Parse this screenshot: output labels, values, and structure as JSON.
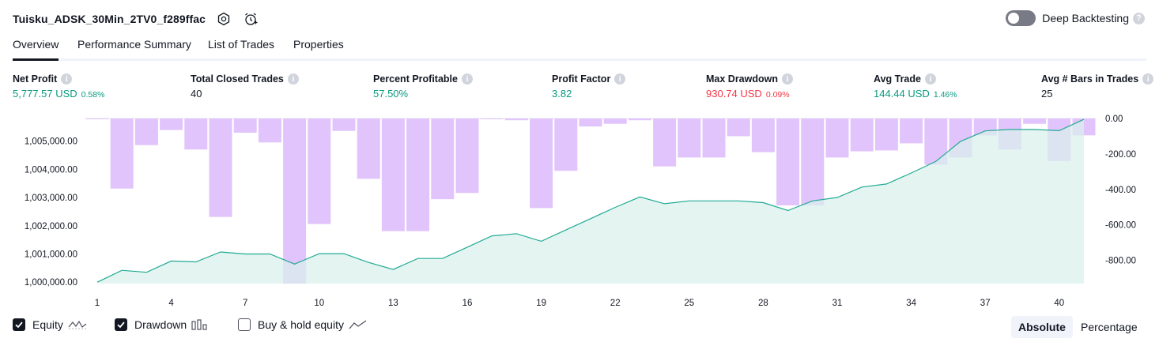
{
  "header": {
    "title": "Tuisku_ADSK_30Min_2TV0_f289ffac"
  },
  "deep_backtesting": {
    "label": "Deep Backtesting",
    "enabled": false
  },
  "tabs": [
    {
      "label": "Overview",
      "active": true
    },
    {
      "label": "Performance Summary",
      "active": false
    },
    {
      "label": "List of Trades",
      "active": false
    },
    {
      "label": "Properties",
      "active": false
    }
  ],
  "stats": {
    "net_profit": {
      "label": "Net Profit",
      "value": "5,777.57 USD",
      "pct": "0.58%"
    },
    "total_closed_trades": {
      "label": "Total Closed Trades",
      "value": "40"
    },
    "percent_profitable": {
      "label": "Percent Profitable",
      "value": "57.50%"
    },
    "profit_factor": {
      "label": "Profit Factor",
      "value": "3.82"
    },
    "max_drawdown": {
      "label": "Max Drawdown",
      "value": "930.74 USD",
      "pct": "0.09%"
    },
    "avg_trade": {
      "label": "Avg Trade",
      "value": "144.44 USD",
      "pct": "1.46%"
    },
    "avg_bars": {
      "label": "Avg # Bars in Trades",
      "value": "25"
    }
  },
  "colors": {
    "equity_line": "#22ab94",
    "equity_fill": "#d8f0eb",
    "drawdown_bar": "#e1c4fb",
    "positive": "#089981",
    "negative": "#f23645"
  },
  "chart_data": {
    "type": "line",
    "x_ticks": [
      "1",
      "4",
      "7",
      "10",
      "13",
      "16",
      "19",
      "22",
      "25",
      "28",
      "31",
      "34",
      "37",
      "40"
    ],
    "left_axis": {
      "ticks": [
        "1,000,000.00",
        "1,001,000.00",
        "1,002,000.00",
        "1,003,000.00",
        "1,004,000.00",
        "1,005,000.00"
      ],
      "range": [
        999950,
        1005800
      ]
    },
    "right_axis": {
      "ticks": [
        "0.00",
        "-200.00",
        "-400.00",
        "-600.00",
        "-800.00"
      ],
      "range": [
        -930.74,
        0
      ]
    },
    "series": [
      {
        "name": "Equity",
        "x": [
          1,
          2,
          3,
          4,
          5,
          6,
          7,
          8,
          9,
          10,
          11,
          12,
          13,
          14,
          15,
          16,
          17,
          18,
          19,
          20,
          21,
          22,
          23,
          24,
          25,
          26,
          27,
          28,
          29,
          30,
          31,
          32,
          33,
          34,
          35,
          36,
          37,
          38,
          39,
          40,
          41
        ],
        "values": [
          1000000,
          1000420,
          1000350,
          1000750,
          1000720,
          1001070,
          1001000,
          1001000,
          1000640,
          1001010,
          1001010,
          1000700,
          1000450,
          1000840,
          1000840,
          1001240,
          1001640,
          1001720,
          1001450,
          1001850,
          1002250,
          1002650,
          1003020,
          1002780,
          1002880,
          1002880,
          1002880,
          1002820,
          1002540,
          1002880,
          1003000,
          1003370,
          1003480,
          1003870,
          1004280,
          1004990,
          1005360,
          1005410,
          1005410,
          1005370,
          1005770
        ]
      },
      {
        "name": "Drawdown",
        "x": [
          1,
          2,
          3,
          4,
          5,
          6,
          7,
          8,
          9,
          10,
          11,
          12,
          13,
          14,
          15,
          16,
          17,
          18,
          19,
          20,
          21,
          22,
          23,
          24,
          25,
          26,
          27,
          28,
          29,
          30,
          31,
          32,
          33,
          34,
          35,
          36,
          37,
          38,
          39,
          40,
          41
        ],
        "values": [
          0,
          -395,
          -150,
          -65,
          -175,
          -555,
          -80,
          -135,
          -930.74,
          -595,
          -70,
          -340,
          -635,
          -635,
          -455,
          -420,
          0,
          -10,
          -505,
          -295,
          -45,
          -30,
          -10,
          -270,
          -220,
          -220,
          -100,
          -190,
          -490,
          -490,
          -220,
          -185,
          -180,
          -140,
          -260,
          -220,
          -95,
          -175,
          -30,
          -240,
          -95
        ]
      }
    ]
  },
  "legend": {
    "equity": {
      "label": "Equity",
      "checked": true
    },
    "drawdown": {
      "label": "Drawdown",
      "checked": true
    },
    "buy_hold": {
      "label": "Buy & hold equity",
      "checked": false
    }
  },
  "modes": {
    "absolute": "Absolute",
    "percentage": "Percentage",
    "selected": "absolute"
  }
}
